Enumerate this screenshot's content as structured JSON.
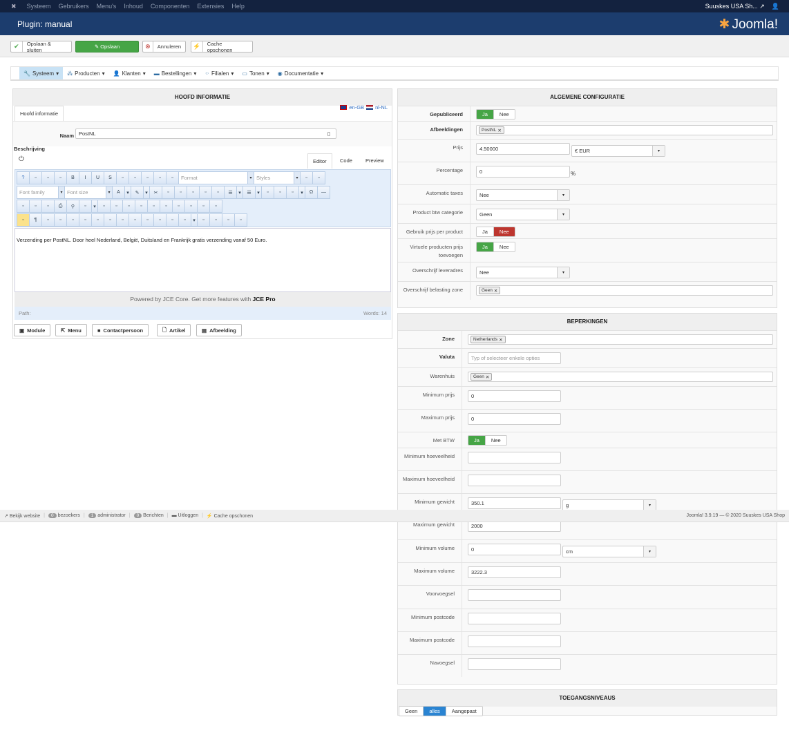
{
  "topnav": {
    "items": [
      "Systeem",
      "Gebruikers",
      "Menu's",
      "Inhoud",
      "Componenten",
      "Extensies",
      "Help"
    ],
    "site": "Suuskes USA Sh...",
    "user_icon": "user-icon"
  },
  "header": {
    "title": "Plugin: manual",
    "logo": "Joomla!"
  },
  "toolbar": {
    "save_close": "Opslaan & sluiten",
    "save": "Opslaan",
    "cancel": "Annuleren",
    "cache": "Cache opschonen"
  },
  "menubar": [
    {
      "label": "Systeem",
      "icon": "wrench-icon"
    },
    {
      "label": "Producten",
      "icon": "cubes-icon"
    },
    {
      "label": "Klanten",
      "icon": "user-icon"
    },
    {
      "label": "Bestellingen",
      "icon": "credit-card-icon"
    },
    {
      "label": "Filialen",
      "icon": "users-icon"
    },
    {
      "label": "Tonen",
      "icon": "monitor-icon"
    },
    {
      "label": "Documentatie",
      "icon": "lifebuoy-icon"
    }
  ],
  "left": {
    "title": "HOOFD INFORMATIE",
    "tab": "Hoofd informatie",
    "lang1": "en-GB",
    "lang2": "nl-NL",
    "name_label": "Naam",
    "name_value": "PostNL",
    "desc_label": "Beschrijving",
    "editor_tabs": [
      "Editor",
      "Code",
      "Preview"
    ],
    "format": "Format",
    "styles": "Styles",
    "font_family": "Font family",
    "font_size": "Font size",
    "content": "Verzending per PostNL. Door heel Nederland, België, Duitsland en Frankrijk gratis verzending vanaf 50 Euro.",
    "powered": "Powered by JCE Core. Get more features with ",
    "powered_bold": "JCE Pro",
    "path": "Path:",
    "words": "Words: 14",
    "buttons": [
      "Module",
      "Menu",
      "Contactpersoon",
      "Artikel",
      "Afbeelding"
    ]
  },
  "config": {
    "title": "ALGEMENE CONFIGURATIE",
    "rows": [
      {
        "label": "Gepubliceerd",
        "bold": true,
        "type": "toggle",
        "on": "Ja",
        "off": "Nee",
        "value": "Ja"
      },
      {
        "label": "Afbeeldingen",
        "bold": true,
        "type": "chips",
        "chips": [
          "PostNL"
        ]
      },
      {
        "label": "Prijs",
        "type": "input-select",
        "value": "4.50000",
        "select": "€ EUR"
      },
      {
        "label": "Percentage",
        "type": "input-suffix",
        "value": "0",
        "suffix": "%"
      },
      {
        "label": "Automatic taxes",
        "type": "select",
        "value": "Nee"
      },
      {
        "label": "Product btw categorie",
        "type": "select",
        "value": "Geen"
      },
      {
        "label": "Gebruik prijs per product",
        "type": "toggle",
        "on": "Ja",
        "off": "Nee",
        "value": "Nee"
      },
      {
        "label": "Virtuele producten prijs toevoegen",
        "type": "toggle",
        "on": "Ja",
        "off": "Nee",
        "value": "Ja"
      },
      {
        "label": "Overschrijf leveradres",
        "type": "select",
        "value": "Nee"
      },
      {
        "label": "Overschrijf belasting zone",
        "type": "chips",
        "chips": [
          "Geen"
        ]
      }
    ]
  },
  "limits": {
    "title": "BEPERKINGEN",
    "rows": [
      {
        "label": "Zone",
        "bold": true,
        "type": "chips",
        "chips": [
          "Netherlands"
        ]
      },
      {
        "label": "Valuta",
        "bold": true,
        "type": "input",
        "value": "",
        "placeholder": "Typ of selecteer enkele opties"
      },
      {
        "label": "Warenhuis",
        "type": "chips",
        "chips": [
          "Geen"
        ]
      },
      {
        "label": "Minimum prijs",
        "type": "input",
        "value": "0"
      },
      {
        "label": "Maximum prijs",
        "type": "input",
        "value": "0"
      },
      {
        "label": "Met BTW",
        "type": "toggle",
        "on": "Ja",
        "off": "Nee",
        "value": "Ja"
      },
      {
        "label": "Minimum hoeveelheid",
        "type": "input",
        "value": ""
      },
      {
        "label": "Maximum hoeveelheid",
        "type": "input",
        "value": ""
      },
      {
        "label": "Minimum gewicht",
        "type": "input-select",
        "value": "350.1",
        "select": "g"
      },
      {
        "label": "Maximum gewicht",
        "type": "input",
        "value": "2000"
      },
      {
        "label": "Minimum volume",
        "type": "input-select",
        "value": "0",
        "select": "cm"
      },
      {
        "label": "Maximum volume",
        "type": "input",
        "value": "3222.3"
      },
      {
        "label": "Voorvoegsel",
        "type": "input",
        "value": ""
      },
      {
        "label": "Minimum postcode",
        "type": "input",
        "value": ""
      },
      {
        "label": "Maximum postcode",
        "type": "input",
        "value": ""
      },
      {
        "label": "Navoegsel",
        "type": "input",
        "value": ""
      }
    ]
  },
  "access": {
    "title": "TOEGANGSNIVEAUS",
    "options": [
      "Geen",
      "alles",
      "Aangepast"
    ],
    "value": "alles"
  },
  "status": {
    "view_site": "Bekijk website",
    "visitors_count": "0",
    "visitors": "bezoekers",
    "admin_count": "1",
    "admin": "administrator",
    "messages_count": "0",
    "messages": "Berichten",
    "logout": "Uitloggen",
    "cache": "Cache opschonen",
    "version": "Joomla! 3.9.19  —  © 2020 Suuskes USA Shop"
  },
  "colors": {
    "green": "#46a546",
    "red": "#bd362f",
    "blue": "#2a84d2",
    "header": "#1c3d6e",
    "topnav": "#13223f"
  }
}
